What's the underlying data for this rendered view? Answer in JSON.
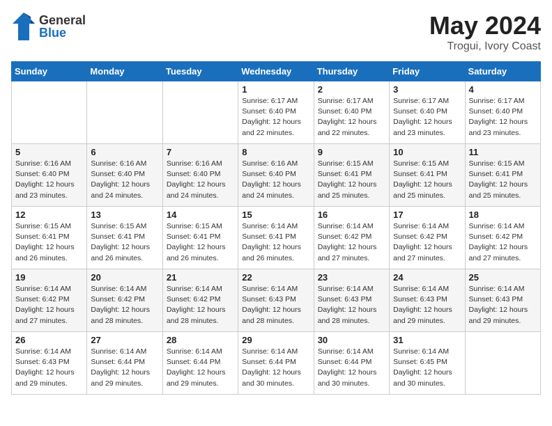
{
  "header": {
    "logo_general": "General",
    "logo_blue": "Blue",
    "title": "May 2024",
    "location": "Trogui, Ivory Coast"
  },
  "days_of_week": [
    "Sunday",
    "Monday",
    "Tuesday",
    "Wednesday",
    "Thursday",
    "Friday",
    "Saturday"
  ],
  "weeks": [
    [
      {
        "day": "",
        "info": ""
      },
      {
        "day": "",
        "info": ""
      },
      {
        "day": "",
        "info": ""
      },
      {
        "day": "1",
        "info": "Sunrise: 6:17 AM\nSunset: 6:40 PM\nDaylight: 12 hours\nand 22 minutes."
      },
      {
        "day": "2",
        "info": "Sunrise: 6:17 AM\nSunset: 6:40 PM\nDaylight: 12 hours\nand 22 minutes."
      },
      {
        "day": "3",
        "info": "Sunrise: 6:17 AM\nSunset: 6:40 PM\nDaylight: 12 hours\nand 23 minutes."
      },
      {
        "day": "4",
        "info": "Sunrise: 6:17 AM\nSunset: 6:40 PM\nDaylight: 12 hours\nand 23 minutes."
      }
    ],
    [
      {
        "day": "5",
        "info": "Sunrise: 6:16 AM\nSunset: 6:40 PM\nDaylight: 12 hours\nand 23 minutes."
      },
      {
        "day": "6",
        "info": "Sunrise: 6:16 AM\nSunset: 6:40 PM\nDaylight: 12 hours\nand 24 minutes."
      },
      {
        "day": "7",
        "info": "Sunrise: 6:16 AM\nSunset: 6:40 PM\nDaylight: 12 hours\nand 24 minutes."
      },
      {
        "day": "8",
        "info": "Sunrise: 6:16 AM\nSunset: 6:40 PM\nDaylight: 12 hours\nand 24 minutes."
      },
      {
        "day": "9",
        "info": "Sunrise: 6:15 AM\nSunset: 6:41 PM\nDaylight: 12 hours\nand 25 minutes."
      },
      {
        "day": "10",
        "info": "Sunrise: 6:15 AM\nSunset: 6:41 PM\nDaylight: 12 hours\nand 25 minutes."
      },
      {
        "day": "11",
        "info": "Sunrise: 6:15 AM\nSunset: 6:41 PM\nDaylight: 12 hours\nand 25 minutes."
      }
    ],
    [
      {
        "day": "12",
        "info": "Sunrise: 6:15 AM\nSunset: 6:41 PM\nDaylight: 12 hours\nand 26 minutes."
      },
      {
        "day": "13",
        "info": "Sunrise: 6:15 AM\nSunset: 6:41 PM\nDaylight: 12 hours\nand 26 minutes."
      },
      {
        "day": "14",
        "info": "Sunrise: 6:15 AM\nSunset: 6:41 PM\nDaylight: 12 hours\nand 26 minutes."
      },
      {
        "day": "15",
        "info": "Sunrise: 6:14 AM\nSunset: 6:41 PM\nDaylight: 12 hours\nand 26 minutes."
      },
      {
        "day": "16",
        "info": "Sunrise: 6:14 AM\nSunset: 6:42 PM\nDaylight: 12 hours\nand 27 minutes."
      },
      {
        "day": "17",
        "info": "Sunrise: 6:14 AM\nSunset: 6:42 PM\nDaylight: 12 hours\nand 27 minutes."
      },
      {
        "day": "18",
        "info": "Sunrise: 6:14 AM\nSunset: 6:42 PM\nDaylight: 12 hours\nand 27 minutes."
      }
    ],
    [
      {
        "day": "19",
        "info": "Sunrise: 6:14 AM\nSunset: 6:42 PM\nDaylight: 12 hours\nand 27 minutes."
      },
      {
        "day": "20",
        "info": "Sunrise: 6:14 AM\nSunset: 6:42 PM\nDaylight: 12 hours\nand 28 minutes."
      },
      {
        "day": "21",
        "info": "Sunrise: 6:14 AM\nSunset: 6:42 PM\nDaylight: 12 hours\nand 28 minutes."
      },
      {
        "day": "22",
        "info": "Sunrise: 6:14 AM\nSunset: 6:43 PM\nDaylight: 12 hours\nand 28 minutes."
      },
      {
        "day": "23",
        "info": "Sunrise: 6:14 AM\nSunset: 6:43 PM\nDaylight: 12 hours\nand 28 minutes."
      },
      {
        "day": "24",
        "info": "Sunrise: 6:14 AM\nSunset: 6:43 PM\nDaylight: 12 hours\nand 29 minutes."
      },
      {
        "day": "25",
        "info": "Sunrise: 6:14 AM\nSunset: 6:43 PM\nDaylight: 12 hours\nand 29 minutes."
      }
    ],
    [
      {
        "day": "26",
        "info": "Sunrise: 6:14 AM\nSunset: 6:43 PM\nDaylight: 12 hours\nand 29 minutes."
      },
      {
        "day": "27",
        "info": "Sunrise: 6:14 AM\nSunset: 6:44 PM\nDaylight: 12 hours\nand 29 minutes."
      },
      {
        "day": "28",
        "info": "Sunrise: 6:14 AM\nSunset: 6:44 PM\nDaylight: 12 hours\nand 29 minutes."
      },
      {
        "day": "29",
        "info": "Sunrise: 6:14 AM\nSunset: 6:44 PM\nDaylight: 12 hours\nand 30 minutes."
      },
      {
        "day": "30",
        "info": "Sunrise: 6:14 AM\nSunset: 6:44 PM\nDaylight: 12 hours\nand 30 minutes."
      },
      {
        "day": "31",
        "info": "Sunrise: 6:14 AM\nSunset: 6:45 PM\nDaylight: 12 hours\nand 30 minutes."
      },
      {
        "day": "",
        "info": ""
      }
    ]
  ]
}
